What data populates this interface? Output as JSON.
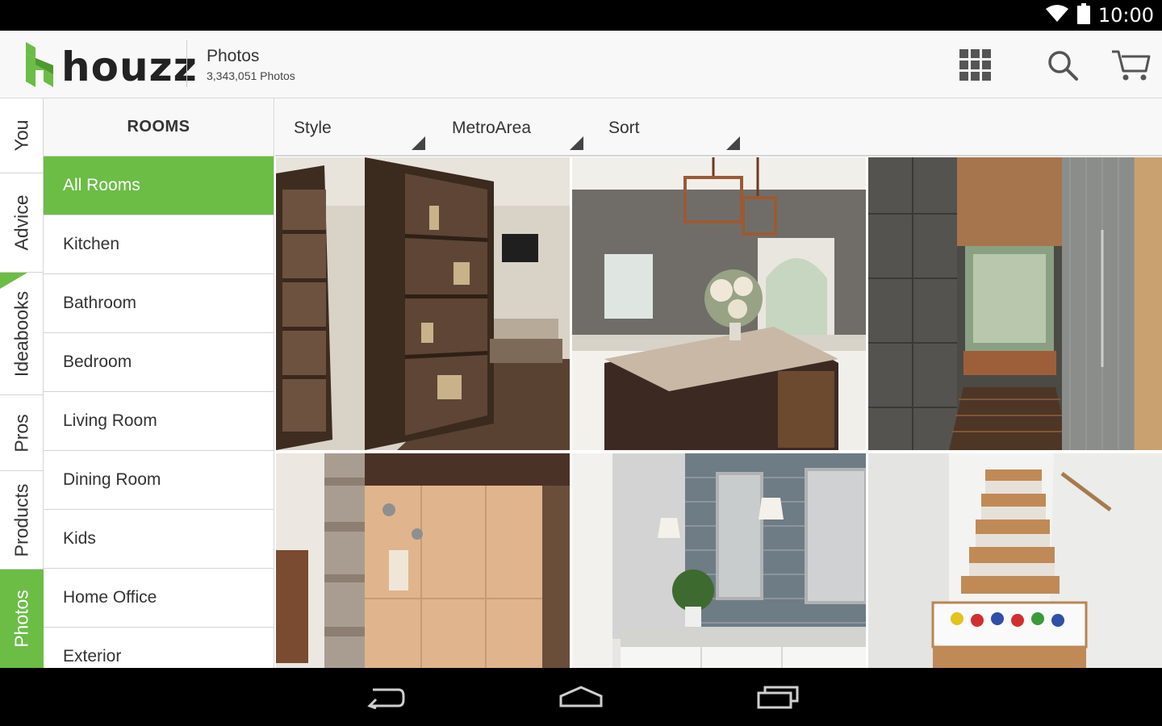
{
  "status_bar": {
    "time": "10:00"
  },
  "header": {
    "logo_text": "houzz",
    "title": "Photos",
    "subtitle": "3,343,051 Photos"
  },
  "brand_color": "#6bbd45",
  "side_tabs": [
    {
      "label": "You",
      "active": false
    },
    {
      "label": "Advice",
      "active": false
    },
    {
      "label": "Ideabooks",
      "active": false
    },
    {
      "label": "Pros",
      "active": false
    },
    {
      "label": "Products",
      "active": false
    },
    {
      "label": "Photos",
      "active": true
    }
  ],
  "rooms": {
    "header": "ROOMS",
    "items": [
      {
        "label": "All Rooms",
        "active": true
      },
      {
        "label": "Kitchen",
        "active": false
      },
      {
        "label": "Bathroom",
        "active": false
      },
      {
        "label": "Bedroom",
        "active": false
      },
      {
        "label": "Living Room",
        "active": false
      },
      {
        "label": "Dining Room",
        "active": false
      },
      {
        "label": "Kids",
        "active": false
      },
      {
        "label": "Home Office",
        "active": false
      },
      {
        "label": "Exterior",
        "active": false
      }
    ]
  },
  "filters": [
    {
      "label": "Style"
    },
    {
      "label": "MetroArea"
    },
    {
      "label": "Sort"
    }
  ],
  "photos": [
    {
      "subject": "hidden bookcase door room"
    },
    {
      "subject": "kitchen with island and lanterns"
    },
    {
      "subject": "walk-in shower with rain head"
    },
    {
      "subject": "stone and travertine shower"
    },
    {
      "subject": "bathroom with grey subway tile"
    },
    {
      "subject": "staircase with shoe drawers"
    }
  ],
  "icons": {
    "apps": "grid-icon",
    "search": "search-icon",
    "cart": "cart-icon",
    "back": "back-icon",
    "home": "home-icon",
    "recents": "recents-icon"
  }
}
